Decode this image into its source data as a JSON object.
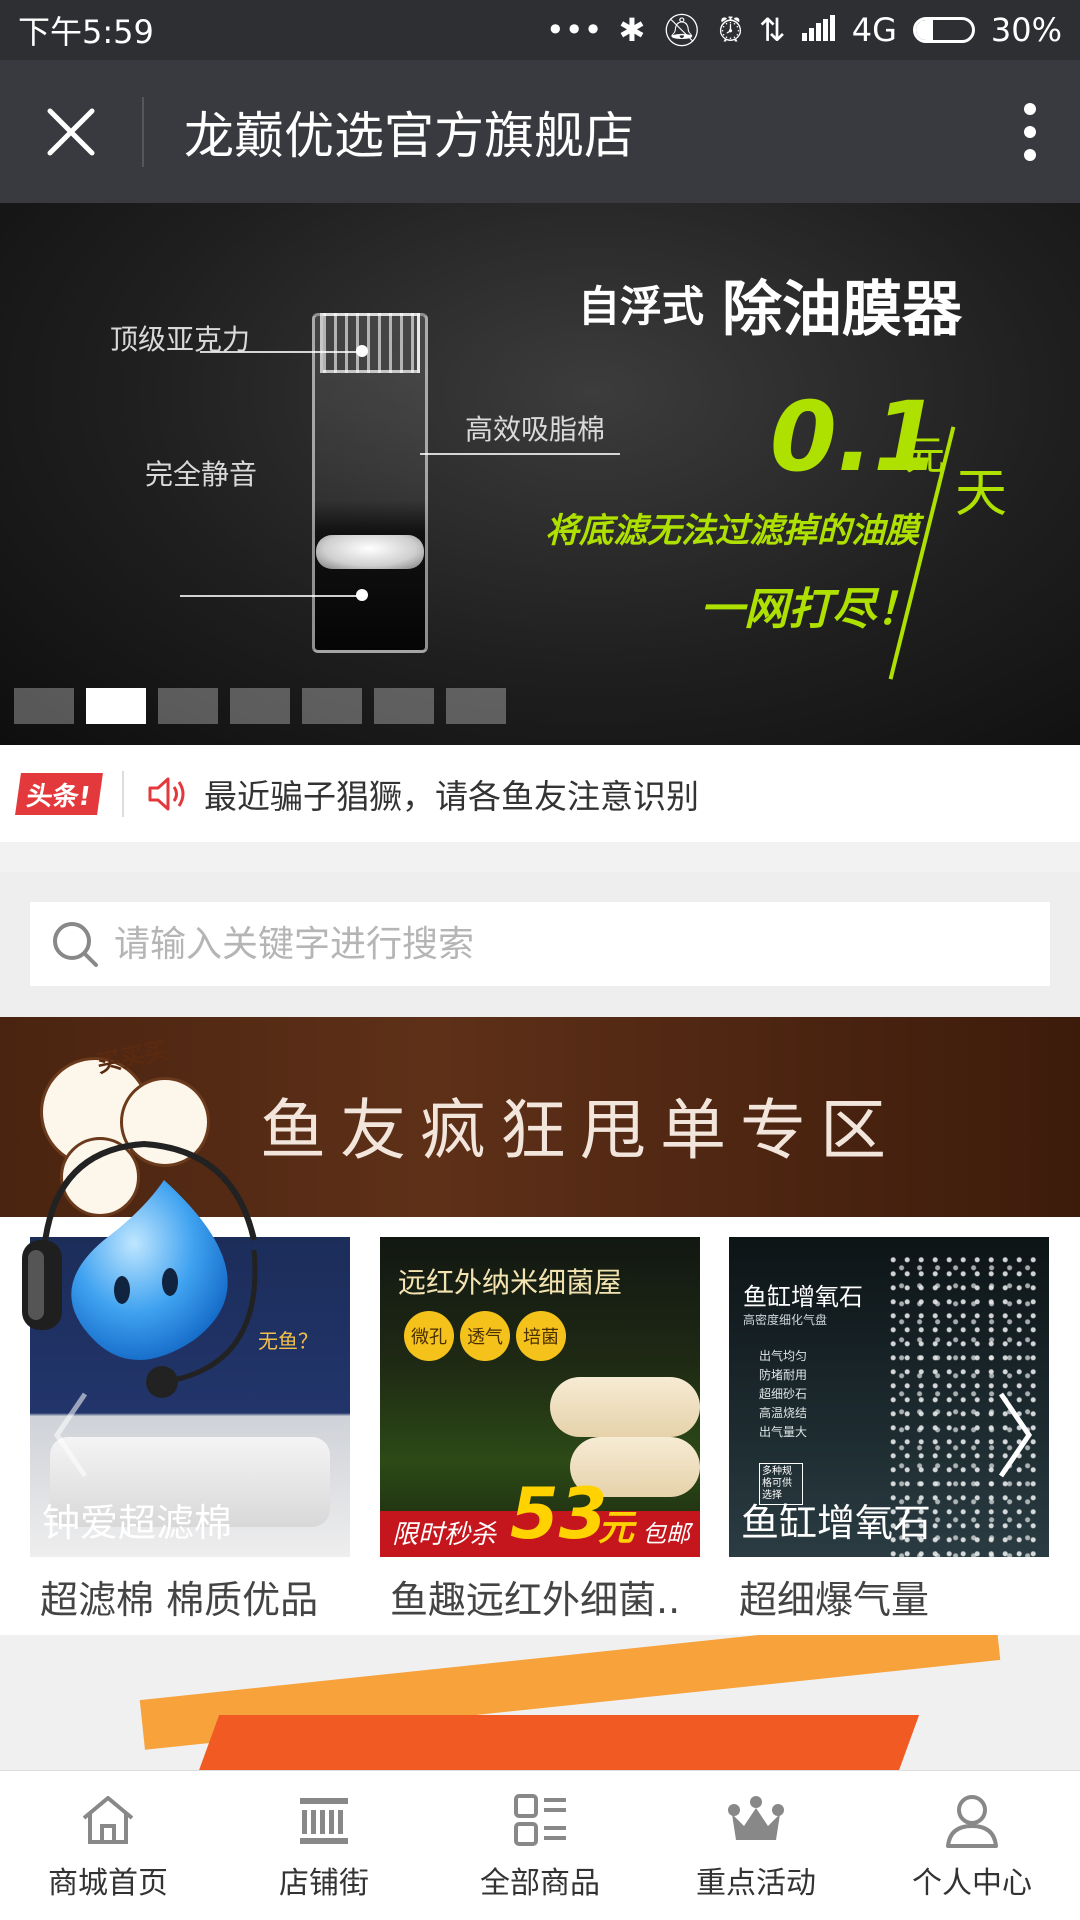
{
  "status_bar": {
    "time": "下午5:59",
    "network": "4G",
    "battery_percent": "30%",
    "battery_level": 0.3
  },
  "header": {
    "title": "龙巅优选官方旗舰店"
  },
  "banner": {
    "label_acrylic": "顶级亚克力",
    "label_foam": "高效吸脂棉",
    "label_silent": "完全静音",
    "headline_prefix": "自浮式",
    "headline_main": "除油膜器",
    "price": "0.1",
    "price_unit": "元",
    "price_per": "天",
    "slogan_line1": "将底滤无法过滤掉的油膜",
    "slogan_line2": "一网打尽！",
    "slide_count": 7,
    "active_slide": 1
  },
  "notice": {
    "badge": "头条!",
    "text": "最近骗子猖獗，请各鱼友注意识别"
  },
  "search": {
    "placeholder": "请输入关键字进行搜索"
  },
  "promo": {
    "title": "鱼友疯狂甩单专区",
    "bubble_text": "买买买"
  },
  "products": [
    {
      "overlay_label": "钟爱超滤棉",
      "title": "超滤棉 棉质优品",
      "image_text": "无鱼？"
    },
    {
      "overlay_label": "限时秒杀",
      "title": "鱼趣远红外细菌..",
      "image_heading": "远红外纳米细菌屋",
      "tags": [
        "微孔",
        "透气",
        "培菌"
      ],
      "price": "53",
      "price_unit": "元",
      "price_note": "包邮"
    },
    {
      "overlay_label": "鱼缸增氧石",
      "title": "超细爆气量",
      "image_heading": "鱼缸增氧石",
      "image_sub": "高密度细化气盘",
      "features": [
        "出气均匀",
        "防堵耐用",
        "超细砂石",
        "高温烧结",
        "出气量大"
      ],
      "badge": "多种规格可供选择"
    }
  ],
  "tabs": [
    {
      "label": "商城首页",
      "icon": "home-icon"
    },
    {
      "label": "店铺街",
      "icon": "storefront-icon"
    },
    {
      "label": "全部商品",
      "icon": "list-icon"
    },
    {
      "label": "重点活动",
      "icon": "crown-icon"
    },
    {
      "label": "个人中心",
      "icon": "user-icon"
    }
  ],
  "colors": {
    "status_bar": "#2d2f33",
    "title_bar": "#393a3f",
    "accent_red": "#e4393c",
    "promo_brown": "#4a2410",
    "banner_green": "#aee000"
  }
}
